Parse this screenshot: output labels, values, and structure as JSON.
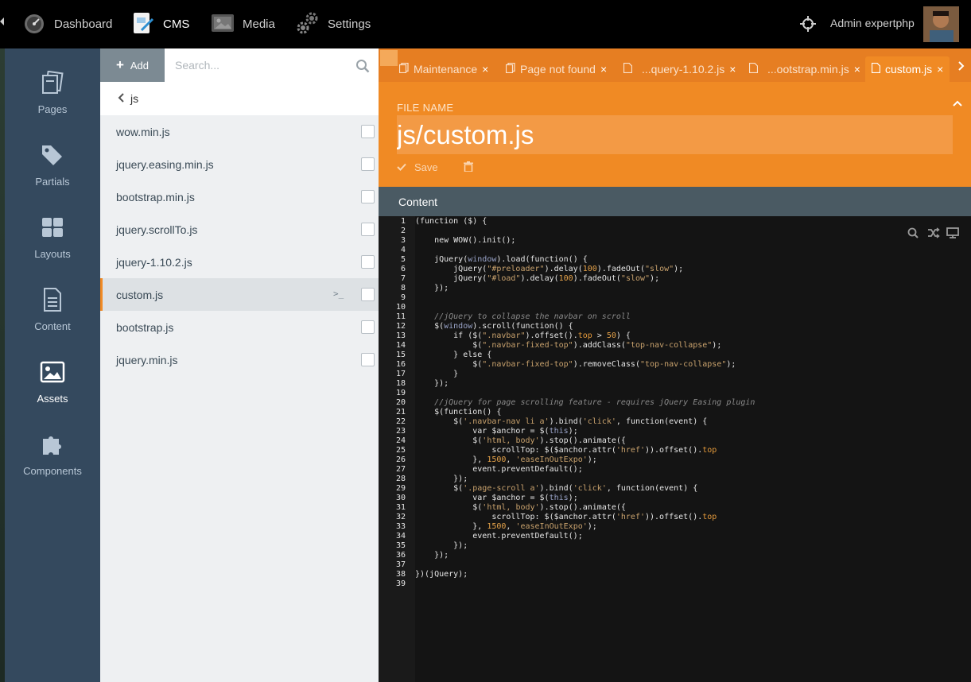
{
  "topbar": {
    "nav": [
      {
        "label": "Dashboard",
        "icon": "speedometer-icon"
      },
      {
        "label": "CMS",
        "icon": "cms-icon"
      },
      {
        "label": "Media",
        "icon": "media-icon"
      },
      {
        "label": "Settings",
        "icon": "settings-icon"
      }
    ],
    "user_name": "Admin expertphp"
  },
  "sidebar": {
    "items": [
      {
        "label": "Pages",
        "icon": "pages-icon"
      },
      {
        "label": "Partials",
        "icon": "tags-icon"
      },
      {
        "label": "Layouts",
        "icon": "layouts-icon"
      },
      {
        "label": "Content",
        "icon": "document-icon"
      },
      {
        "label": "Assets",
        "icon": "image-icon"
      },
      {
        "label": "Components",
        "icon": "puzzle-icon"
      }
    ],
    "active": "Assets"
  },
  "filepanel": {
    "add_label": "Add",
    "search_placeholder": "Search...",
    "breadcrumb": "js",
    "files": [
      "wow.min.js",
      "jquery.easing.min.js",
      "bootstrap.min.js",
      "jquery.scrollTo.js",
      "jquery-1.10.2.js",
      "custom.js",
      "bootstrap.js",
      "jquery.min.js"
    ],
    "active_file": "custom.js"
  },
  "tabs": [
    {
      "label": "Maintenance",
      "icon": "pages-icon"
    },
    {
      "label": "Page not found",
      "icon": "pages-icon"
    },
    {
      "label": "...query-1.10.2.js",
      "icon": "file-icon"
    },
    {
      "label": "...ootstrap.min.js",
      "icon": "file-icon"
    },
    {
      "label": "custom.js",
      "icon": "file-icon",
      "active": true
    }
  ],
  "editor": {
    "file_name_label": "FILE NAME",
    "file_name": "js/custom.js",
    "save_label": "Save",
    "content_label": "Content"
  },
  "colors": {
    "accent": "#f08a24",
    "tabbar": "#e67e22",
    "sidebar": "#34495e",
    "code_bg": "#141414"
  },
  "code_lines": [
    "(function ($) {",
    "",
    "    new WOW().init();",
    "",
    "    jQuery(window).load(function() {",
    "        jQuery(\"#preloader\").delay(100).fadeOut(\"slow\");",
    "        jQuery(\"#load\").delay(100).fadeOut(\"slow\");",
    "    });",
    "",
    "",
    "    //jQuery to collapse the navbar on scroll",
    "    $(window).scroll(function() {",
    "        if ($(\".navbar\").offset().top > 50) {",
    "            $(\".navbar-fixed-top\").addClass(\"top-nav-collapse\");",
    "        } else {",
    "            $(\".navbar-fixed-top\").removeClass(\"top-nav-collapse\");",
    "        }",
    "    });",
    "",
    "    //jQuery for page scrolling feature - requires jQuery Easing plugin",
    "    $(function() {",
    "        $('.navbar-nav li a').bind('click', function(event) {",
    "            var $anchor = $(this);",
    "            $('html, body').stop().animate({",
    "                scrollTop: $($anchor.attr('href')).offset().top",
    "            }, 1500, 'easeInOutExpo');",
    "            event.preventDefault();",
    "        });",
    "        $('.page-scroll a').bind('click', function(event) {",
    "            var $anchor = $(this);",
    "            $('html, body').stop().animate({",
    "                scrollTop: $($anchor.attr('href')).offset().top",
    "            }, 1500, 'easeInOutExpo');",
    "            event.preventDefault();",
    "        });",
    "    });",
    "",
    "})(jQuery);",
    ""
  ]
}
